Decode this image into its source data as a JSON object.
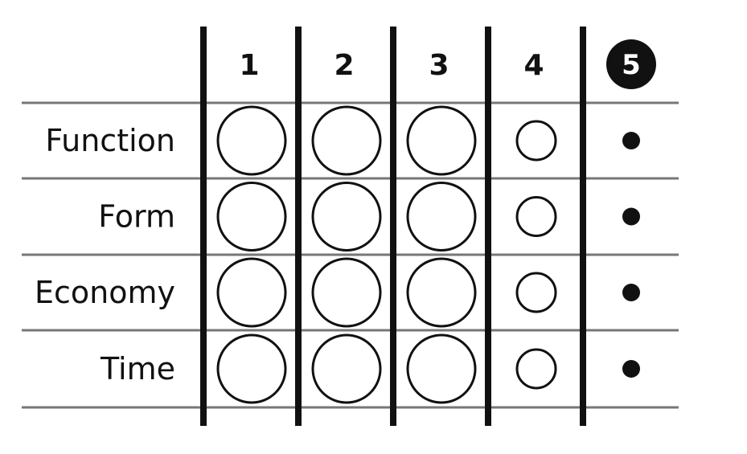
{
  "diagram": {
    "columns": [
      {
        "label": "1",
        "highlighted": false
      },
      {
        "label": "2",
        "highlighted": false
      },
      {
        "label": "3",
        "highlighted": false
      },
      {
        "label": "4",
        "highlighted": false
      },
      {
        "label": "5",
        "highlighted": true
      }
    ],
    "rows": [
      {
        "label": "Function"
      },
      {
        "label": "Form"
      },
      {
        "label": "Economy"
      },
      {
        "label": "Time"
      }
    ],
    "cell_marks": [
      [
        "large-circle",
        "large-circle",
        "large-circle",
        "small-circle",
        "dot"
      ],
      [
        "large-circle",
        "large-circle",
        "large-circle",
        "small-circle",
        "dot"
      ],
      [
        "large-circle",
        "large-circle",
        "large-circle",
        "small-circle",
        "dot"
      ],
      [
        "large-circle",
        "large-circle",
        "large-circle",
        "small-circle",
        "dot"
      ]
    ],
    "colors": {
      "ink": "#111111",
      "rule": "#777777",
      "background": "#ffffff"
    }
  }
}
